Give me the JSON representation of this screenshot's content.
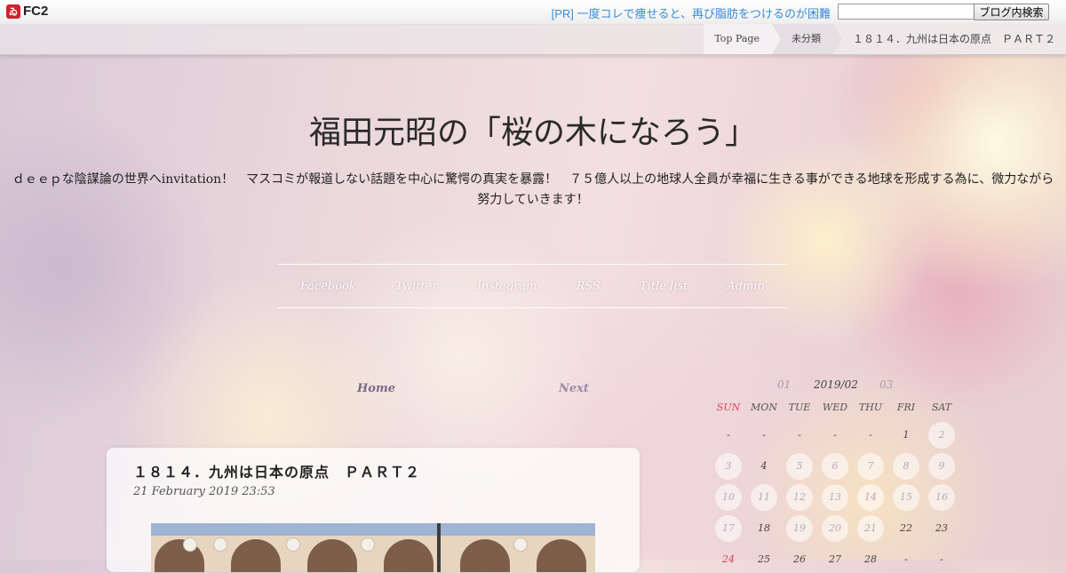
{
  "fc2": {
    "logo_text": "FC2",
    "pr_text": "[PR] 一度コレで痩せると、再び脂肪をつけるのが困難",
    "search_placeholder": "",
    "search_button": "ブログ内検索"
  },
  "breadcrumb": {
    "items": [
      "Top Page",
      "未分類",
      "１８１４．九州は日本の原点　ＰＡＲＴ２"
    ]
  },
  "site": {
    "title": "福田元昭の「桜の木になろう」",
    "description": "ｄｅｅｐな陰謀論の世界へinvitation！　マスコミが報道しない話題を中心に驚愕の真実を暴露！　７５億人以上の地球人全員が幸福に生きる事ができる地球を形成する為に、微力ながら努力していきます！"
  },
  "nav": [
    "Facebook",
    "Twitter",
    "Instagram",
    "RSS",
    "Title list",
    "Admin"
  ],
  "pager": {
    "home": "Home",
    "next": "Next"
  },
  "article": {
    "title": "１８１４．九州は日本の原点　ＰＡＲＴ２",
    "date": "21 February 2019 23:53"
  },
  "calendar": {
    "prev": "01",
    "current": "2019/02",
    "next": "03",
    "weekdays": [
      "SUN",
      "MON",
      "TUE",
      "WED",
      "THU",
      "FRI",
      "SAT"
    ],
    "weeks": [
      [
        "-",
        "-",
        "-",
        "-",
        "-",
        "1",
        "2"
      ],
      [
        "3",
        "4",
        "5",
        "6",
        "7",
        "8",
        "9"
      ],
      [
        "10",
        "11",
        "12",
        "13",
        "14",
        "15",
        "16"
      ],
      [
        "17",
        "18",
        "19",
        "20",
        "21",
        "22",
        "23"
      ],
      [
        "24",
        "25",
        "26",
        "27",
        "28",
        "-",
        "-"
      ]
    ],
    "highlighted_days": [
      "2",
      "3",
      "5",
      "6",
      "7",
      "8",
      "9",
      "10",
      "11",
      "12",
      "13",
      "14",
      "15",
      "16",
      "17",
      "19",
      "20",
      "21"
    ]
  },
  "colors": {
    "sunday": "#d6465b",
    "pr_link": "#3b8bd4"
  }
}
